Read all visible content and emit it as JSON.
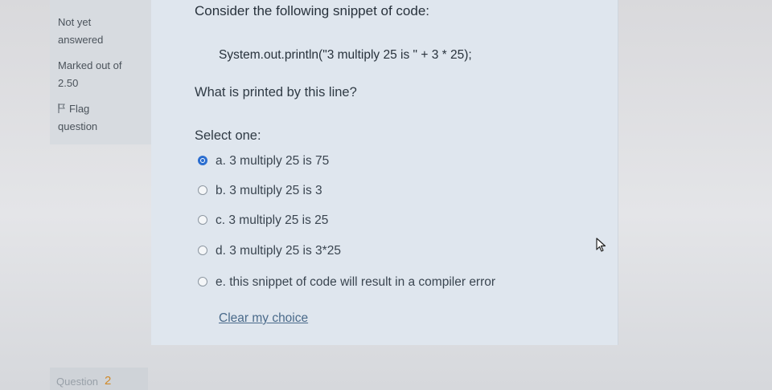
{
  "info": {
    "status_line1": "Not yet",
    "status_line2": "answered",
    "marked_line1": "Marked out of",
    "marked_line2": "2.50",
    "flag_line1": "Flag",
    "flag_line2": "question"
  },
  "question": {
    "intro": "Consider the following snippet of code:",
    "code": "System.out.println(\"3 multiply 25 is \" + 3 * 25);",
    "prompt": "What is printed by this line?",
    "select_label": "Select one:",
    "options": [
      {
        "label": "a. 3 multiply 25 is 75",
        "selected": true
      },
      {
        "label": "b. 3 multiply 25 is 3",
        "selected": false
      },
      {
        "label": "c. 3 multiply 25 is 25",
        "selected": false
      },
      {
        "label": "d. 3 multiply 25 is 3*25",
        "selected": false
      },
      {
        "label": "e. this snippet of code will result in a compiler error",
        "selected": false
      }
    ],
    "clear_label": "Clear my choice"
  },
  "next_question": {
    "label": "Question",
    "number": "2"
  }
}
